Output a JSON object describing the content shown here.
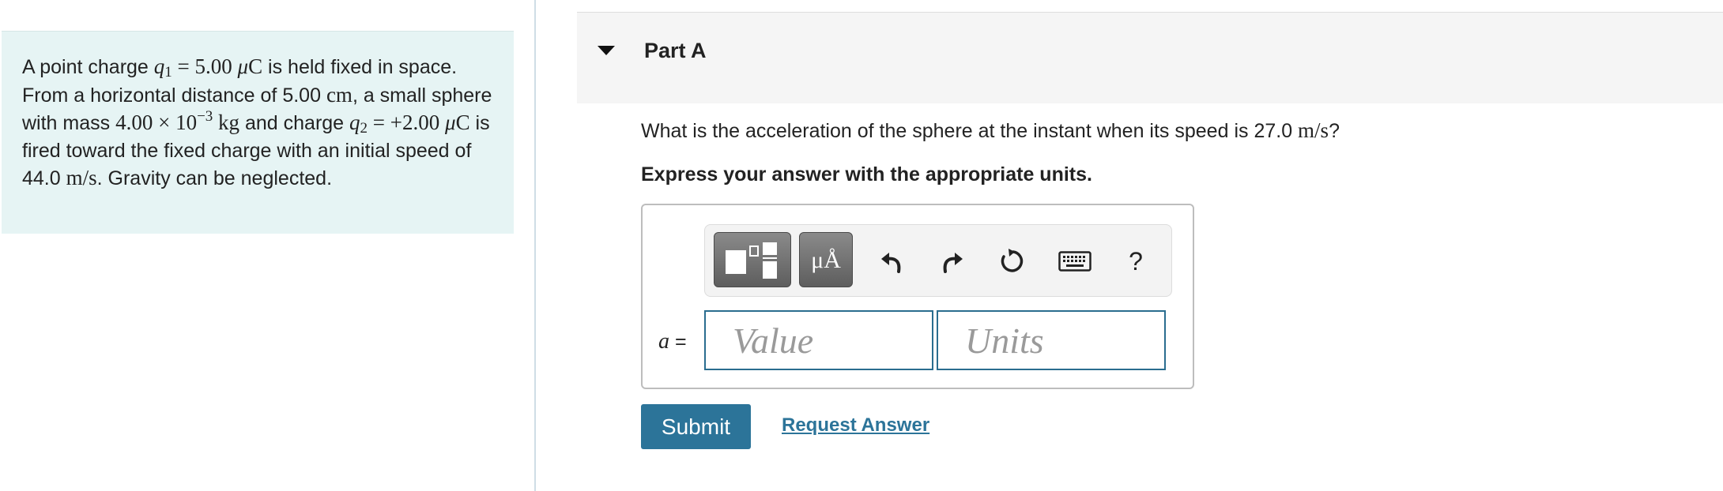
{
  "problem": {
    "segments": [
      {
        "t": "A point charge ",
        "c": ""
      },
      {
        "t": "q",
        "c": "mi"
      },
      {
        "t": "1",
        "c": "sub"
      },
      {
        "t": " = 5.00 ",
        "c": "m"
      },
      {
        "t": "μ",
        "c": "mi"
      },
      {
        "t": "C",
        "c": "m"
      },
      {
        "t": " is held fixed in space. From a horizontal distance of 5.00 ",
        "c": ""
      },
      {
        "t": "cm",
        "c": "m"
      },
      {
        "t": ", a small sphere with mass ",
        "c": ""
      },
      {
        "t": "4.00 × 10",
        "c": "m"
      },
      {
        "t": "−3",
        "c": "sup"
      },
      {
        "t": " kg",
        "c": "m"
      },
      {
        "t": " and charge ",
        "c": ""
      },
      {
        "t": "q",
        "c": "mi"
      },
      {
        "t": "2",
        "c": "sub"
      },
      {
        "t": " = +2.00 ",
        "c": "m"
      },
      {
        "t": "μ",
        "c": "mi"
      },
      {
        "t": "C",
        "c": "m"
      },
      {
        "t": " is fired toward the fixed charge with an initial speed of 44.0 ",
        "c": ""
      },
      {
        "t": "m/s",
        "c": "m"
      },
      {
        "t": ". Gravity can be neglected.",
        "c": ""
      }
    ]
  },
  "part": {
    "title": "Part A",
    "question_prefix": "What is the acceleration of the sphere at the instant when its speed is 27.0 ",
    "question_unit": "m/s",
    "question_suffix": "?",
    "instruction": "Express your answer with the appropriate units."
  },
  "toolbar": {
    "units_label": "μÅ",
    "help_label": "?",
    "icons": [
      "templates-icon",
      "units-icon",
      "undo-icon",
      "redo-icon",
      "reset-icon",
      "keyboard-icon",
      "help-icon"
    ]
  },
  "answer": {
    "variable": "a",
    "equals": " =",
    "value_placeholder": "Value",
    "units_placeholder": "Units"
  },
  "actions": {
    "submit_label": "Submit",
    "request_answer_label": "Request Answer"
  },
  "colors": {
    "problem_bg": "#e6f4f4",
    "accent": "#2c7499",
    "field_border": "#2a6d8f"
  }
}
